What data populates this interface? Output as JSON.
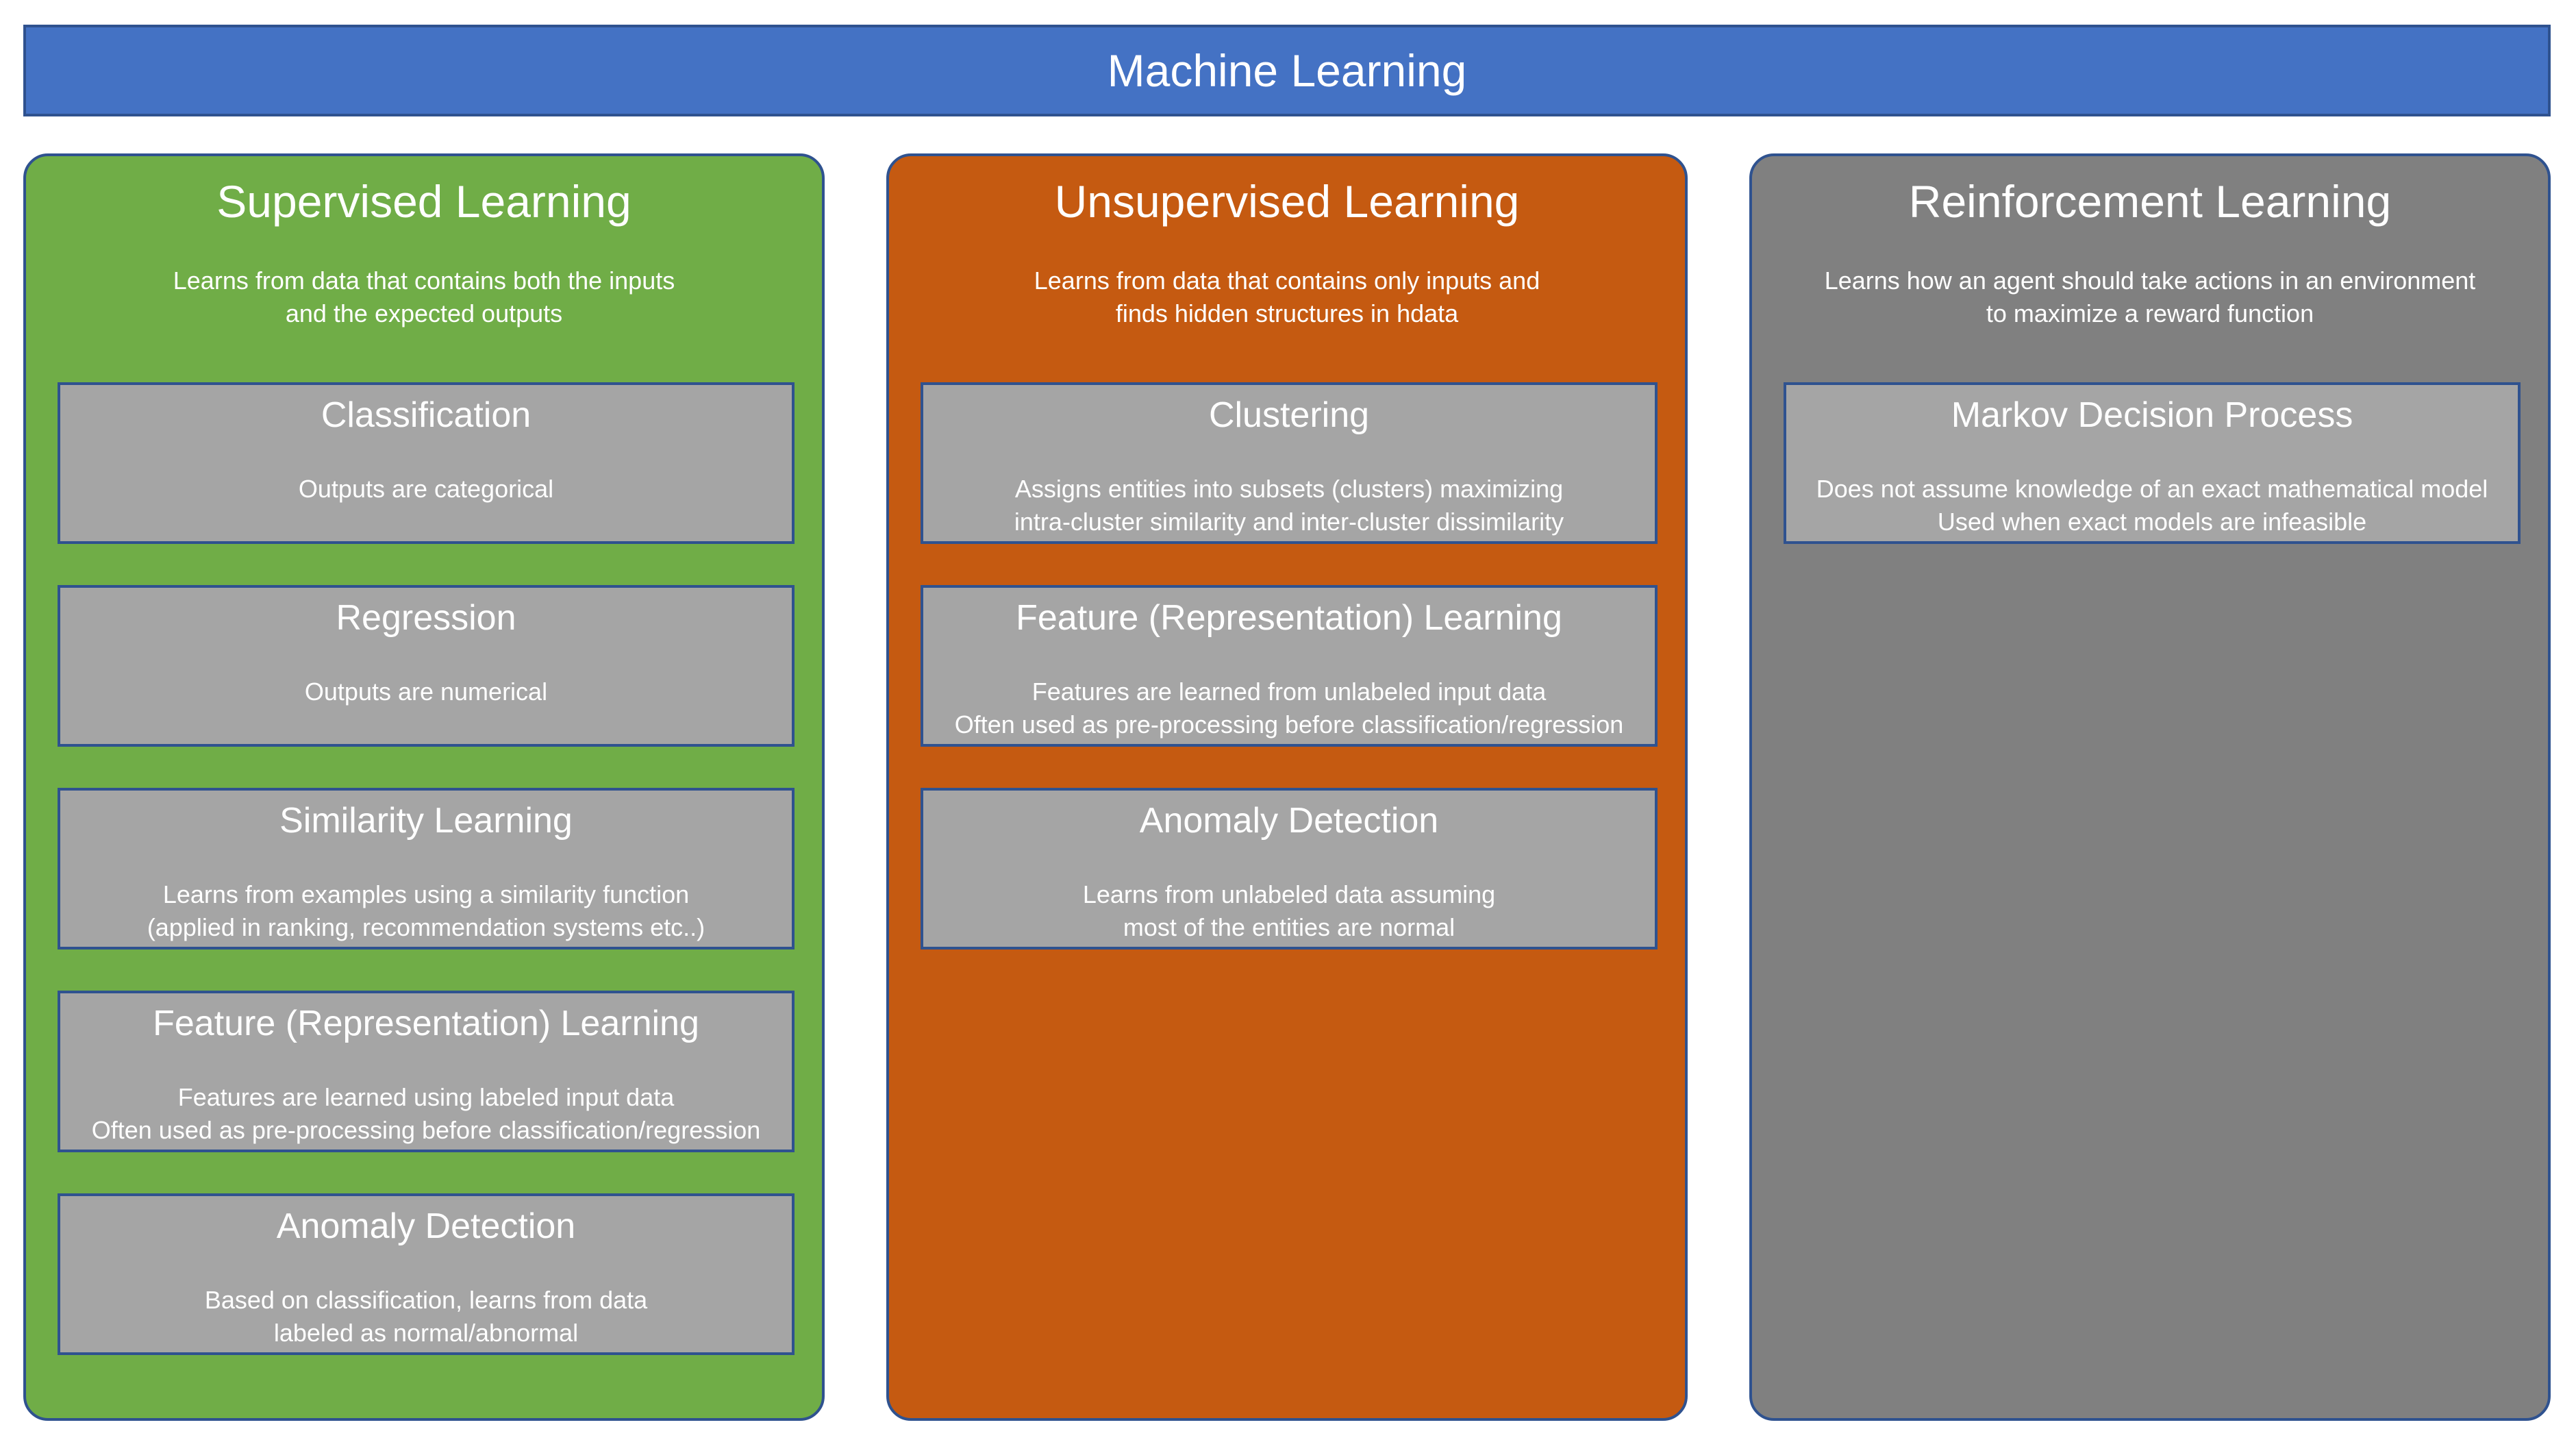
{
  "colors": {
    "header": "#4472C4",
    "border": "#2F528F",
    "supervised": "#70AD47",
    "unsupervised": "#C55A11",
    "reinforcement": "#808080",
    "card": "#A5A5A5",
    "text": "#FFFFFF"
  },
  "header": {
    "title": "Machine Learning"
  },
  "columns": [
    {
      "title": "Supervised Learning",
      "description": [
        "Learns from data that contains both the inputs",
        "and the expected outputs"
      ],
      "cards": [
        {
          "title": "Classification",
          "lines": [
            "Outputs are categorical"
          ]
        },
        {
          "title": "Regression",
          "lines": [
            "Outputs are numerical"
          ]
        },
        {
          "title": "Similarity Learning",
          "lines": [
            "Learns from examples using a similarity function",
            "(applied in ranking, recommendation systems etc..)"
          ]
        },
        {
          "title": "Feature (Representation) Learning",
          "lines": [
            "Features are learned using labeled input data",
            "Often used as pre-processing before classification/regression"
          ]
        },
        {
          "title": "Anomaly Detection",
          "lines": [
            "Based on classification, learns from data",
            "labeled as normal/abnormal"
          ]
        }
      ]
    },
    {
      "title": "Unsupervised Learning",
      "description": [
        "Learns from data that contains only inputs and",
        "finds hidden structures in hdata"
      ],
      "cards": [
        {
          "title": "Clustering",
          "lines": [
            "Assigns entities into subsets (clusters) maximizing",
            "intra-cluster similarity and inter-cluster dissimilarity"
          ]
        },
        {
          "title": "Feature (Representation) Learning",
          "lines": [
            "Features are learned from unlabeled input data",
            "Often used as pre-processing before classification/regression"
          ]
        },
        {
          "title": "Anomaly Detection",
          "lines": [
            "Learns from unlabeled data assuming",
            "most of the entities are normal"
          ]
        }
      ]
    },
    {
      "title": "Reinforcement Learning",
      "description": [
        "Learns how an agent should take actions in an environment",
        "to maximize a reward function"
      ],
      "cards": [
        {
          "title": "Markov Decision Process",
          "lines": [
            "Does not assume knowledge of an exact mathematical model",
            "Used when exact models are infeasible"
          ]
        }
      ]
    }
  ]
}
